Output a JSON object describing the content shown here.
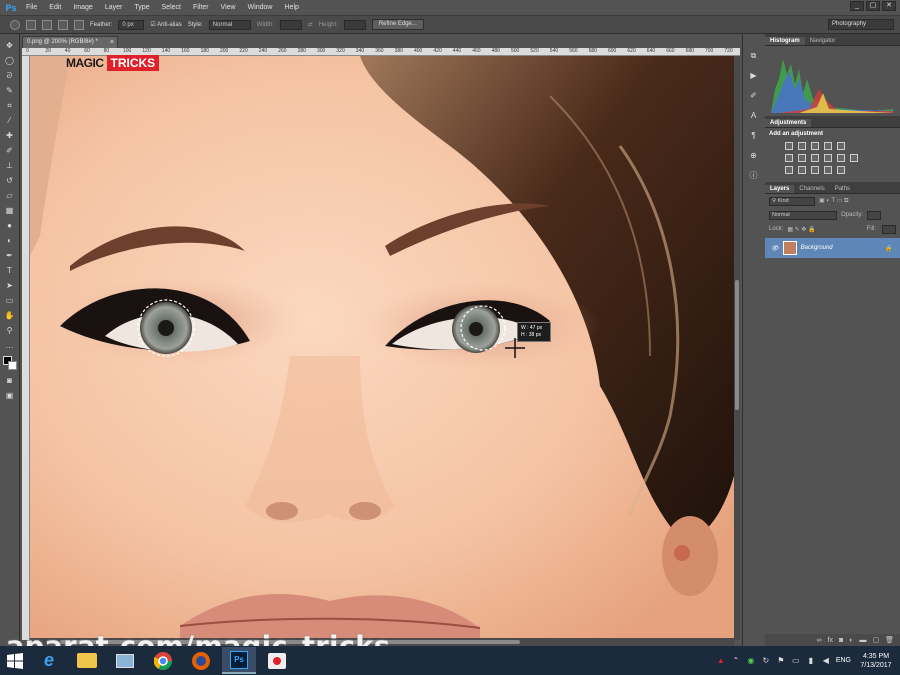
{
  "app": {
    "name": "Ps"
  },
  "menu": [
    "File",
    "Edit",
    "Image",
    "Layer",
    "Type",
    "Select",
    "Filter",
    "View",
    "Window",
    "Help"
  ],
  "window_controls": [
    "_",
    "▢",
    "✕"
  ],
  "options": {
    "feather_label": "Feather:",
    "feather_value": "0 px",
    "antialias_label": "Anti-alias",
    "style_label": "Style:",
    "style_value": "Normal",
    "width_label": "Width:",
    "height_label": "Height:",
    "refine_edge": "Refine Edge...",
    "workspace": "Photography"
  },
  "document": {
    "tab_title": "0.png @ 200% (RGB/8#) *",
    "close": "×"
  },
  "ruler": {
    "ticks": [
      "0",
      "20",
      "40",
      "60",
      "80",
      "100",
      "120",
      "140",
      "160",
      "180",
      "200",
      "220",
      "240",
      "260",
      "280",
      "300",
      "320",
      "340",
      "360",
      "380",
      "400",
      "420",
      "440",
      "460",
      "480",
      "500",
      "520",
      "540",
      "560",
      "580",
      "600",
      "620",
      "640",
      "660",
      "680",
      "700",
      "720"
    ]
  },
  "brand": {
    "magic": "MAGIC",
    "tricks": "TRICKS"
  },
  "selection_tooltip": {
    "w": "W : 47 px",
    "h": "H : 38 px"
  },
  "watermark": "aparat.com/magic_tricks",
  "panels": {
    "histogram_tabs": [
      "Histogram",
      "Navigator"
    ],
    "adjustments_tab": "Adjustments",
    "add_adjustment": "Add an adjustment",
    "layers_tabs": [
      "Layers",
      "Channels",
      "Paths"
    ],
    "kind": "Kind",
    "blend_mode": "Normal",
    "opacity_label": "Opacity:",
    "lock_label": "Lock:",
    "fill_label": "Fill:",
    "layer_name": "Background",
    "footer_icons": [
      "link",
      "fx",
      "mask",
      "adjust",
      "folder",
      "new",
      "trash"
    ]
  },
  "taskbar": {
    "lang": "ENG",
    "time": "4:35 PM",
    "date": "7/13/2017"
  },
  "colors": {
    "ps_blue": "#31a8ff",
    "brand_red": "#e0212b",
    "layer_selected": "#5e86b6"
  }
}
